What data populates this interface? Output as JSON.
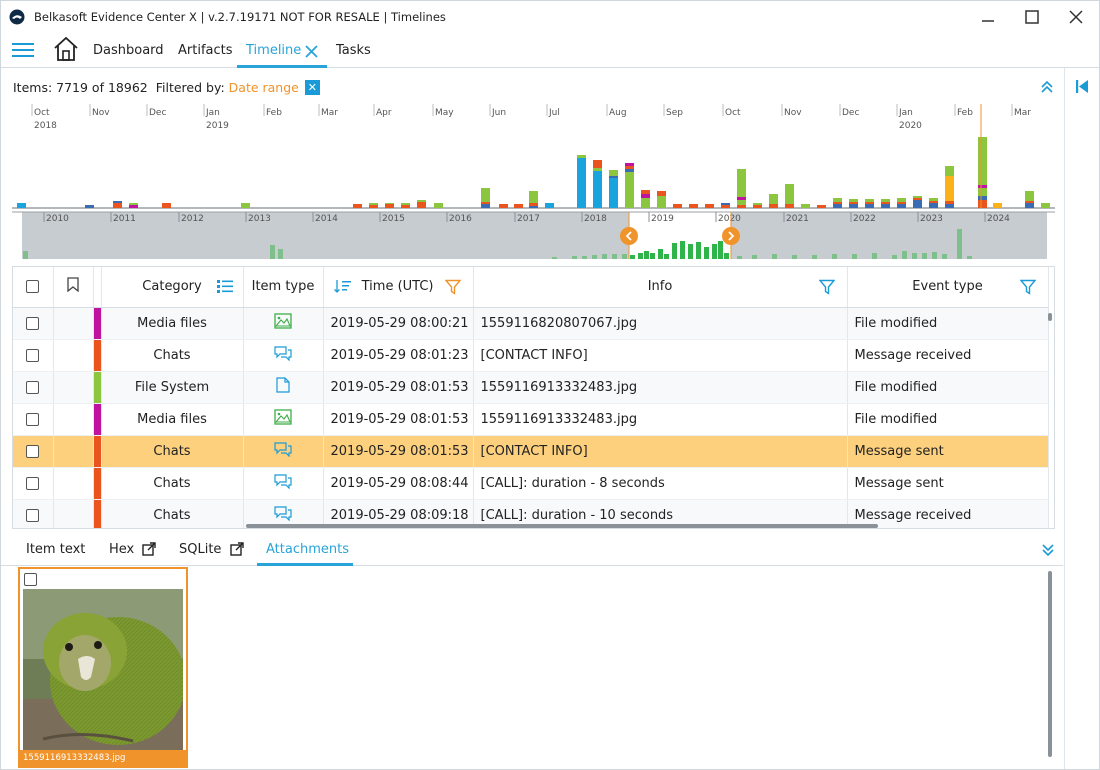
{
  "window": {
    "title": "Belkasoft Evidence Center X | v.2.7.19171 NOT FOR RESALE | Timelines"
  },
  "menu": {
    "dashboard": "Dashboard",
    "artifacts": "Artifacts",
    "timeline": "Timeline",
    "tasks": "Tasks"
  },
  "filter": {
    "items_text": "Items: 7719 of 18962",
    "filtered_by": "Filtered by:",
    "range": "Date range"
  },
  "timeline": {
    "top_months": [
      {
        "m": "Oct",
        "y": "2018"
      },
      {
        "m": "Nov",
        "y": ""
      },
      {
        "m": "Dec",
        "y": ""
      },
      {
        "m": "Jan",
        "y": "2019"
      },
      {
        "m": "Feb",
        "y": ""
      },
      {
        "m": "Mar",
        "y": ""
      },
      {
        "m": "Apr",
        "y": ""
      },
      {
        "m": "May",
        "y": ""
      },
      {
        "m": "Jun",
        "y": ""
      },
      {
        "m": "Jul",
        "y": ""
      },
      {
        "m": "Aug",
        "y": ""
      },
      {
        "m": "Sep",
        "y": ""
      },
      {
        "m": "Oct",
        "y": ""
      },
      {
        "m": "Nov",
        "y": ""
      },
      {
        "m": "Dec",
        "y": ""
      },
      {
        "m": "Jan",
        "y": "2020"
      },
      {
        "m": "Feb",
        "y": ""
      },
      {
        "m": "Mar",
        "y": ""
      }
    ],
    "bottom_years": [
      "2010",
      "2011",
      "2012",
      "2013",
      "2014",
      "2015",
      "2016",
      "2017",
      "2018",
      "2019",
      "2020",
      "2021",
      "2022",
      "2023",
      "2024"
    ],
    "colors": {
      "blue": "#1aa3dc",
      "green": "#8cc63f",
      "orange": "#e9541f",
      "purple": "#c0139f",
      "navy": "#3a6cb4",
      "yellow": "#fbb117",
      "gray": "#9aa0a6"
    }
  },
  "grid": {
    "headers": {
      "category": "Category",
      "item_type": "Item type",
      "time": "Time (UTC)",
      "info": "Info",
      "event_type": "Event type"
    },
    "rows": [
      {
        "category": "Media files",
        "cat_color": "#c0139f",
        "type_icon": "image-icon",
        "time": "2019-05-29 08:00:21",
        "info": "1559116820807067.jpg",
        "event": "File modified"
      },
      {
        "category": "Chats",
        "cat_color": "#e9541f",
        "type_icon": "chat-icon",
        "time": "2019-05-29 08:01:23",
        "info": "[CONTACT INFO]",
        "event": "Message received"
      },
      {
        "category": "File System",
        "cat_color": "#8cc63f",
        "type_icon": "file-icon",
        "time": "2019-05-29 08:01:53",
        "info": "1559116913332483.jpg",
        "event": "File modified"
      },
      {
        "category": "Media files",
        "cat_color": "#c0139f",
        "type_icon": "image-icon",
        "time": "2019-05-29 08:01:53",
        "info": "1559116913332483.jpg",
        "event": "File modified"
      },
      {
        "category": "Chats",
        "cat_color": "#e9541f",
        "type_icon": "chat-icon",
        "time": "2019-05-29 08:01:53",
        "info": "[CONTACT INFO]",
        "event": "Message sent"
      },
      {
        "category": "Chats",
        "cat_color": "#e9541f",
        "type_icon": "chat-icon",
        "time": "2019-05-29 08:08:44",
        "info": "[CALL]: duration - 8 seconds",
        "event": "Message sent"
      },
      {
        "category": "Chats",
        "cat_color": "#e9541f",
        "type_icon": "chat-icon",
        "time": "2019-05-29 08:09:18",
        "info": "[CALL]: duration - 10 seconds",
        "event": "Message received"
      }
    ],
    "selected_row": 4
  },
  "lower_tabs": {
    "item_text": "Item text",
    "hex": "Hex",
    "sqlite": "SQLite",
    "attachments": "Attachments"
  },
  "attachment": {
    "filename": "1559116913332483.jpg"
  }
}
